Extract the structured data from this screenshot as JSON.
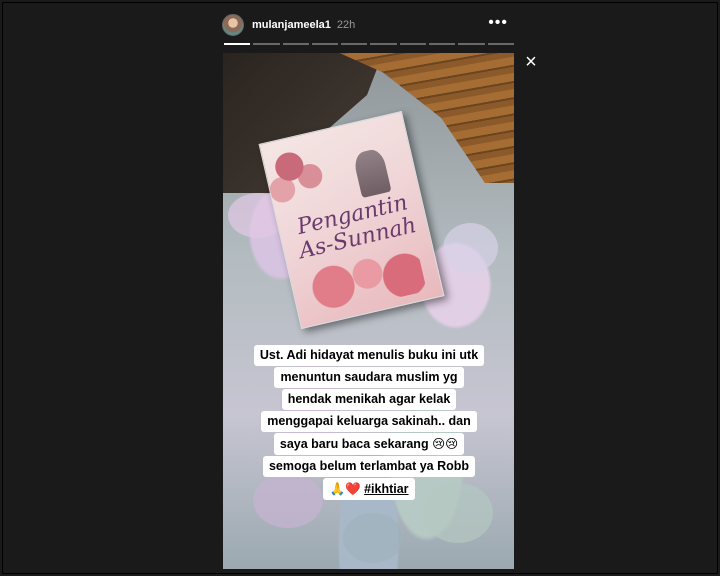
{
  "header": {
    "username": "mulanjameela1",
    "time": "22h",
    "more_label": "•••"
  },
  "progress": {
    "segments_total": 10,
    "current_segment": 1
  },
  "close_label": "×",
  "book": {
    "title_line1": "Pengantin",
    "title_line2": "As-Sunnah"
  },
  "caption": {
    "lines": [
      "Ust. Adi hidayat menulis buku ini utk",
      "menuntun saudara muslim yg",
      "hendak menikah agar kelak",
      "menggapai keluarga sakinah.. dan",
      "saya baru baca sekarang",
      "semoga belum terlambat ya Robb"
    ],
    "line5_emoji": "😢😢",
    "last_emoji": "🙏❤️",
    "hashtag": "#ikhtiar"
  },
  "colors": {
    "background": "#1a1a1a",
    "caption_bg": "#ffffff",
    "book_title": "#6a3a6c"
  }
}
